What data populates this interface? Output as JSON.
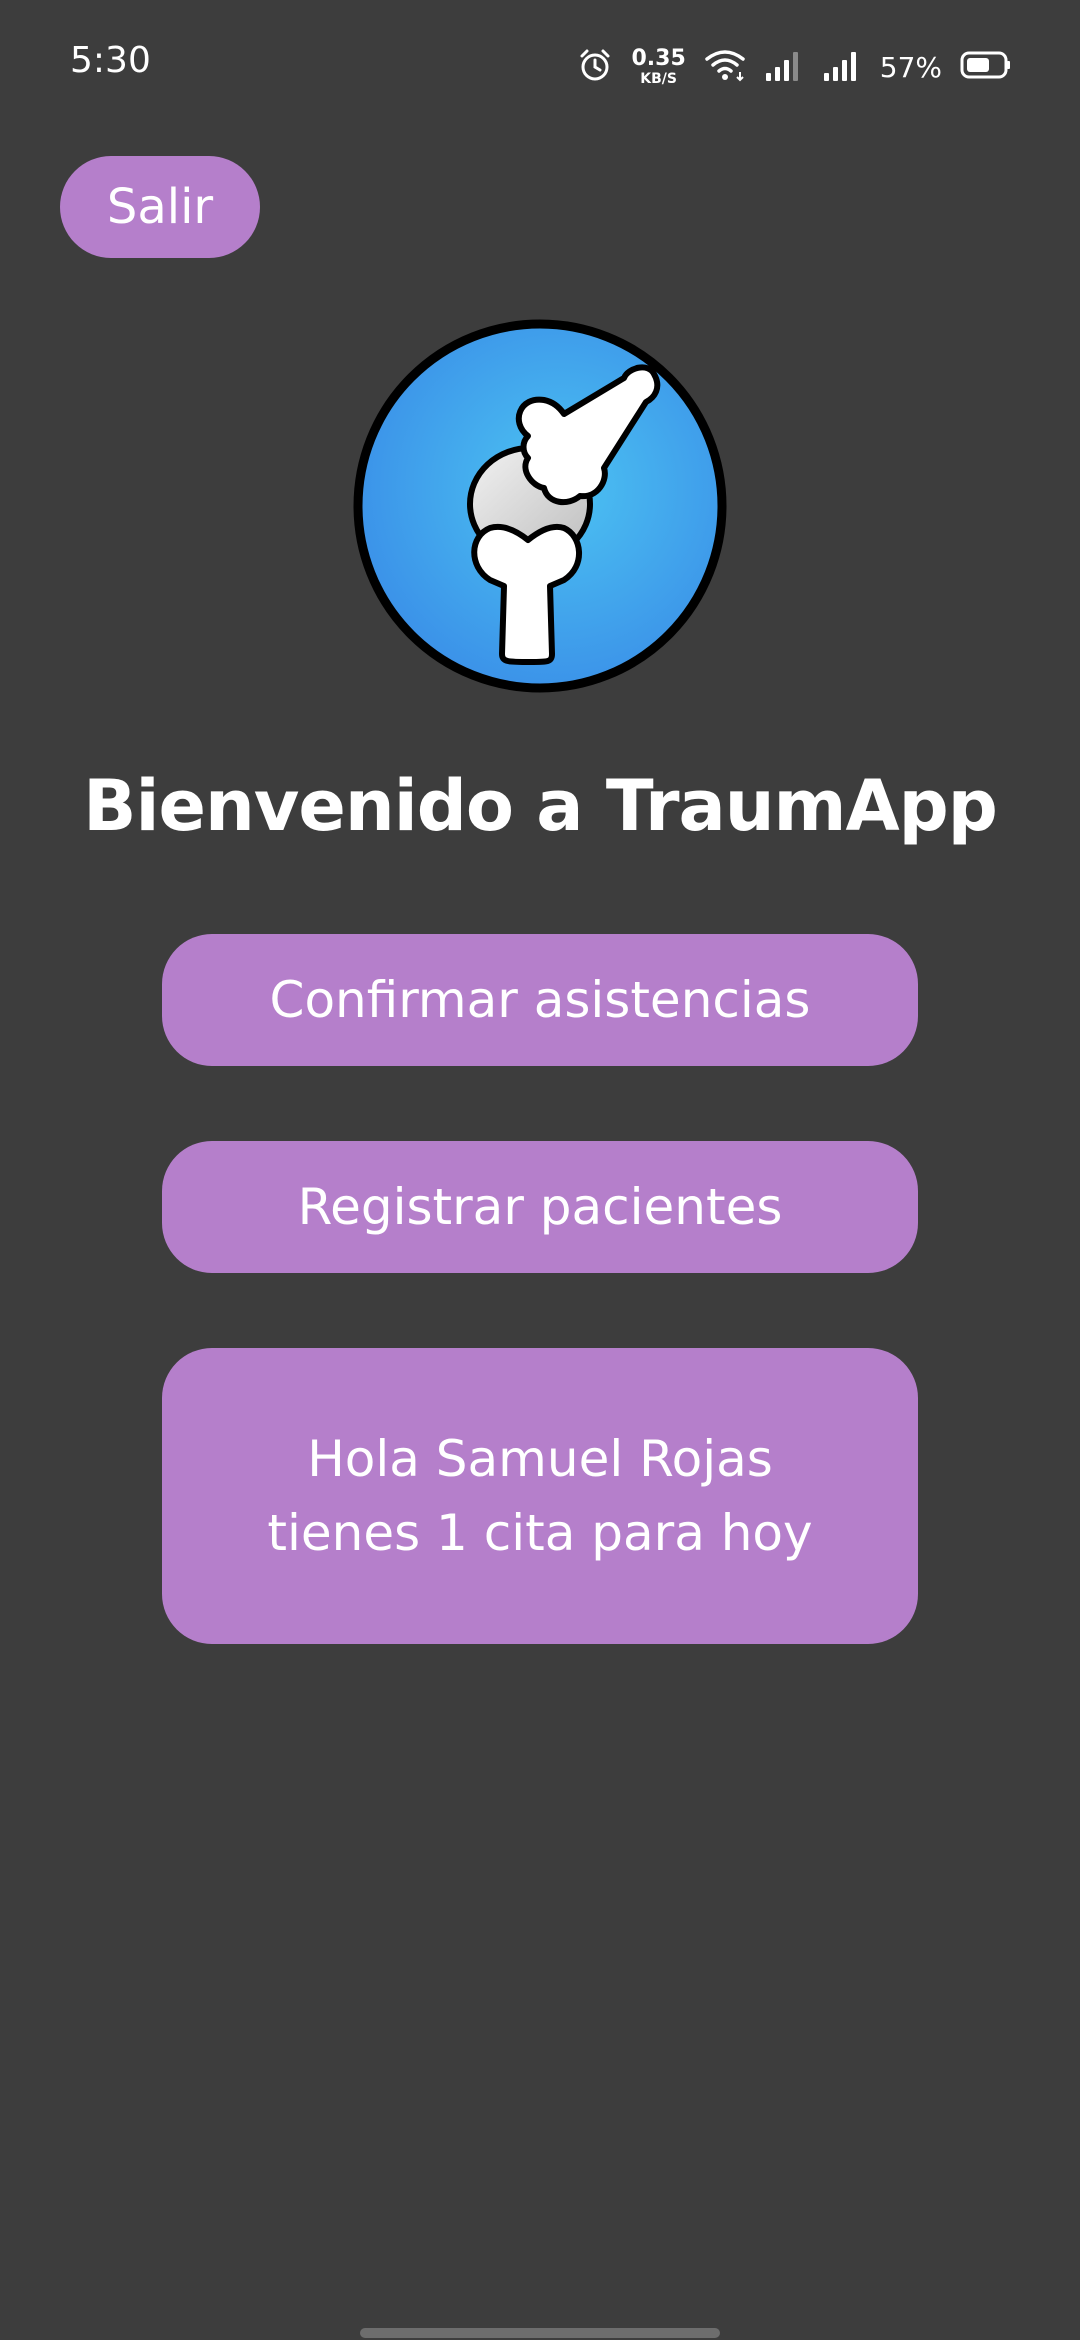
{
  "status_bar": {
    "time": "5:30",
    "net_speed_value": "0.35",
    "net_speed_unit": "KB/S",
    "battery_percent": "57%",
    "icons": [
      "alarm-icon",
      "wifi-icon",
      "signal-icon",
      "signal-icon",
      "battery-icon"
    ]
  },
  "header": {
    "logout_label": "Salir"
  },
  "logo": {
    "icon": "knee-bone-logo",
    "colors": {
      "circle": "#3ea5ee",
      "border": "#000000",
      "bone": "#ffffff"
    }
  },
  "main": {
    "title": "Bienvenido a TraumApp",
    "confirm_label": "Confirmar asistencias",
    "register_label": "Registrar pacientes",
    "greeting_line1": "Hola Samuel Rojas",
    "greeting_line2": "tienes 1 cita para hoy"
  },
  "colors": {
    "background": "#3d3d3d",
    "accent": "#b57fcb",
    "text": "#ffffff"
  }
}
